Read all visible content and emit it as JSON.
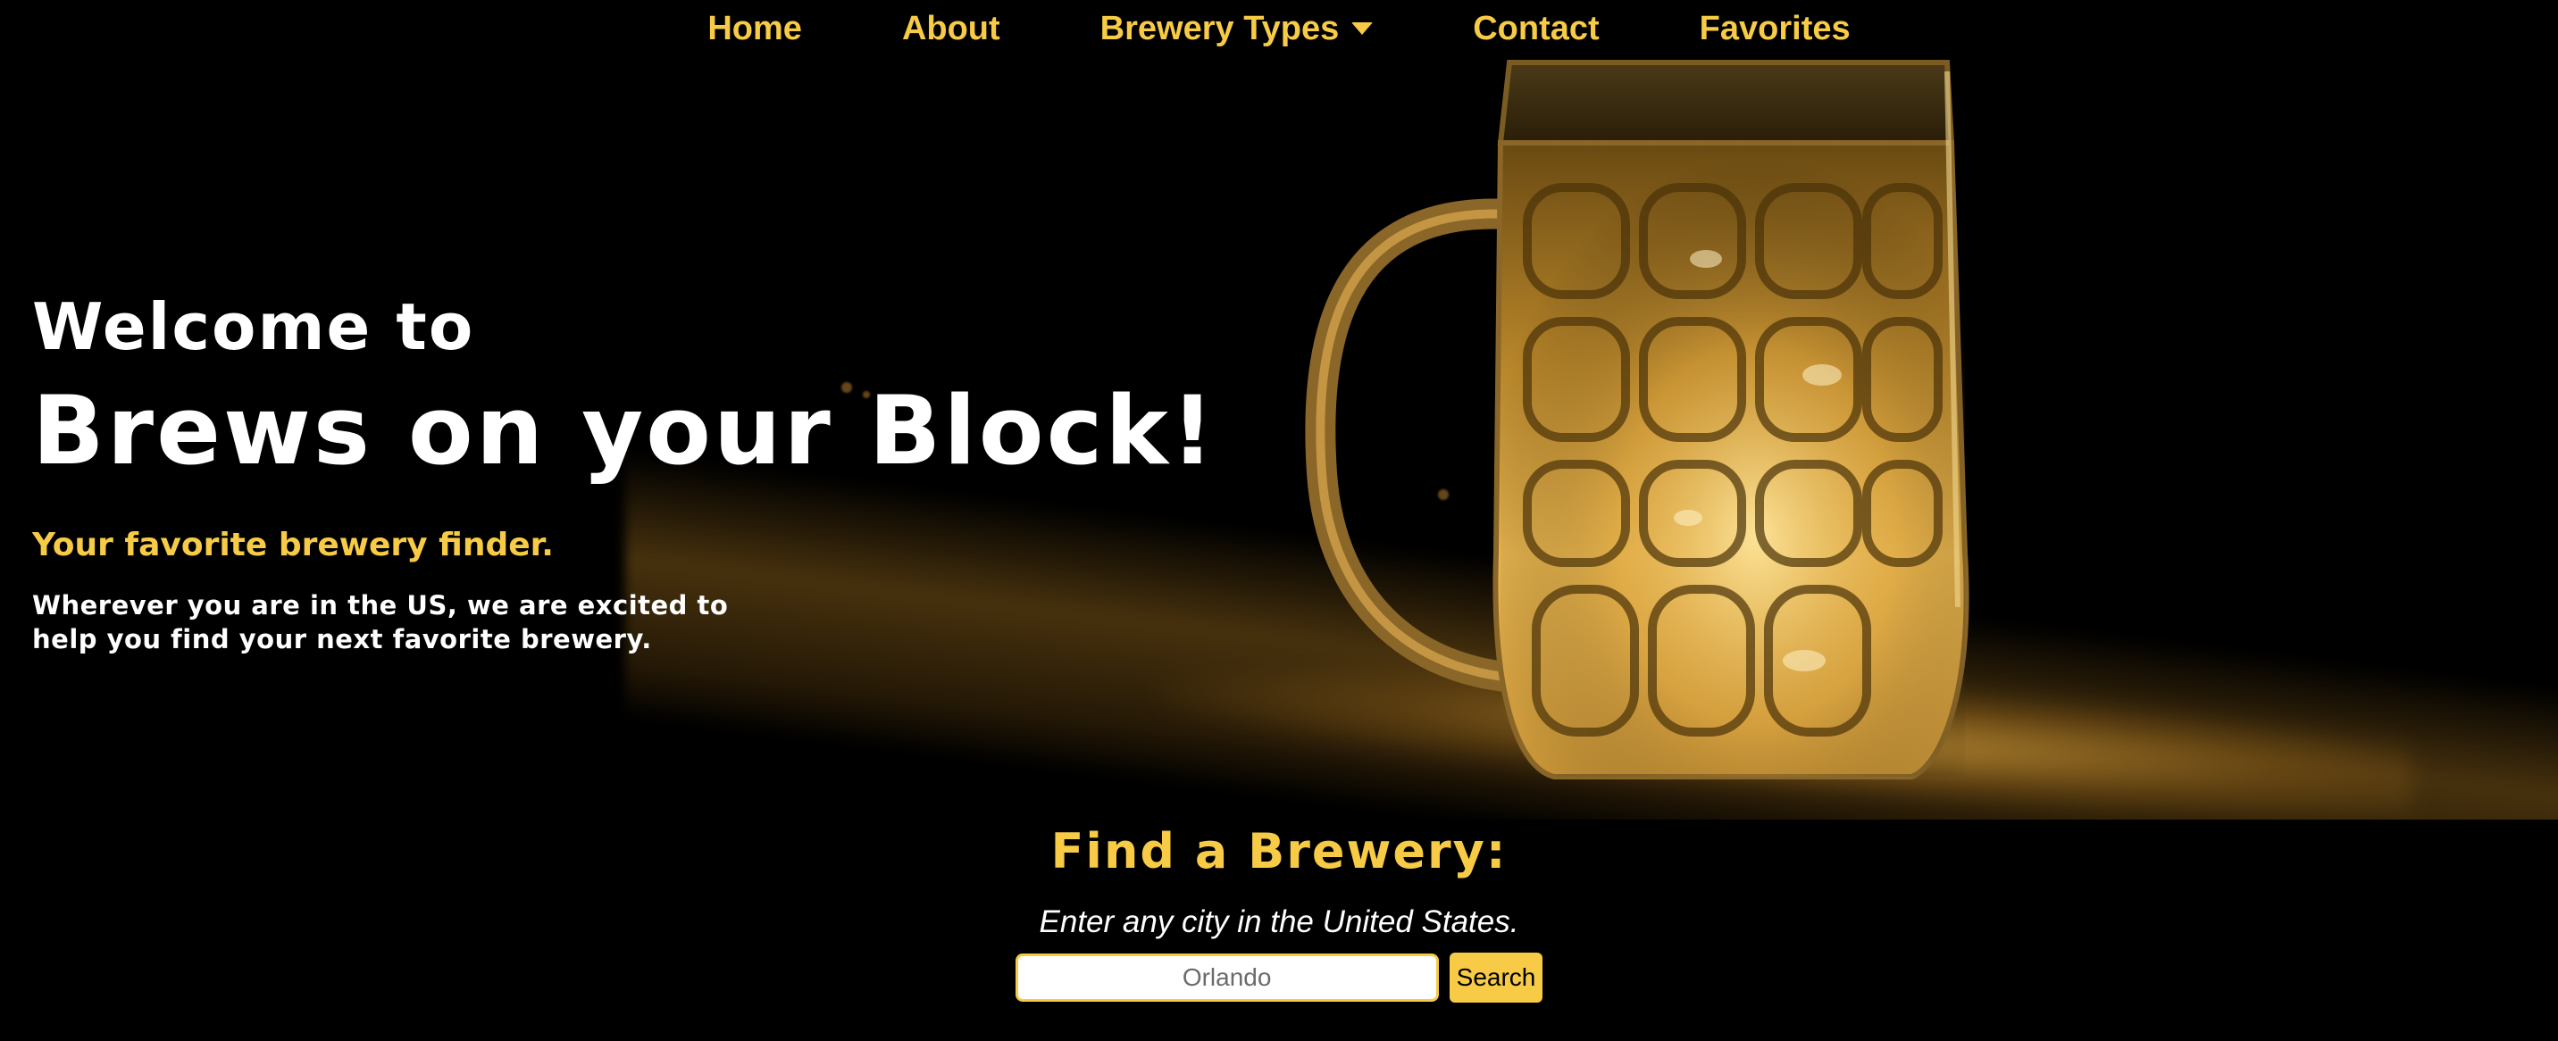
{
  "nav": {
    "items": [
      {
        "label": "Home"
      },
      {
        "label": "About"
      },
      {
        "label": "Brewery Types"
      },
      {
        "label": "Contact"
      },
      {
        "label": "Favorites"
      }
    ]
  },
  "hero": {
    "welcome": "Welcome to",
    "brand": "Brews on your Block!",
    "tagline": "Your favorite brewery finder.",
    "blurb": "Wherever you are in the US, we are excited to help you find your next favorite brewery."
  },
  "search": {
    "title": "Find a Brewery:",
    "subtitle": "Enter any city in the United States.",
    "placeholder": "Orlando",
    "button_label": "Search"
  },
  "colors": {
    "accent": "#f7cb46",
    "background": "#000000",
    "text": "#ffffff"
  },
  "icons": {
    "dropdown": "caret-down-icon",
    "hero_image": "beer-mug-image"
  }
}
